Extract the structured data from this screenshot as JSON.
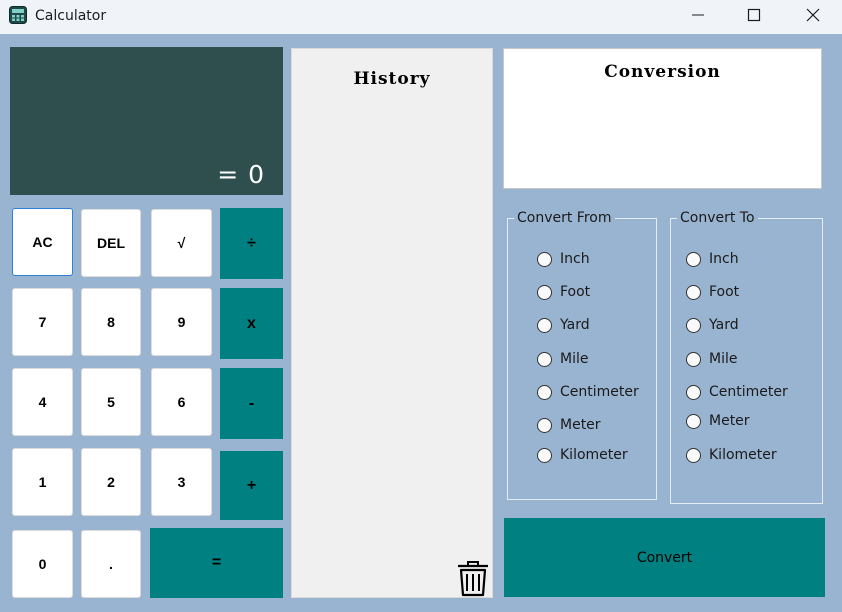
{
  "window": {
    "title": "Calculator",
    "app_icon": "calculator-app-icon",
    "controls": [
      "minimize-icon",
      "maximize-icon",
      "close-icon"
    ]
  },
  "display": {
    "text": "= 0"
  },
  "keypad": {
    "ac": "AC",
    "del": "DEL",
    "sqrt": "√",
    "divide": "÷",
    "seven": "7",
    "eight": "8",
    "nine": "9",
    "multiply": "x",
    "four": "4",
    "five": "5",
    "six": "6",
    "subtract": "-",
    "one": "1",
    "two": "2",
    "three": "3",
    "add": "+",
    "zero": "0",
    "decimal": ".",
    "equals": "="
  },
  "history": {
    "title": "History",
    "clear_icon": "trash-icon"
  },
  "conversion": {
    "title": "Conversion",
    "from": {
      "legend": "Convert From",
      "options": [
        "Inch",
        "Foot",
        "Yard",
        "Mile",
        "Centimeter",
        "Meter",
        "Kilometer"
      ]
    },
    "to": {
      "legend": "Convert To",
      "options": [
        "Inch",
        "Foot",
        "Yard",
        "Mile",
        "Centimeter",
        "Meter",
        "Kilometer"
      ]
    },
    "button_label": "Convert"
  },
  "colors": {
    "background": "#99b4d1",
    "display": "#2f4f4f",
    "accent": "#008080",
    "titlebar": "#f0f4f9"
  }
}
